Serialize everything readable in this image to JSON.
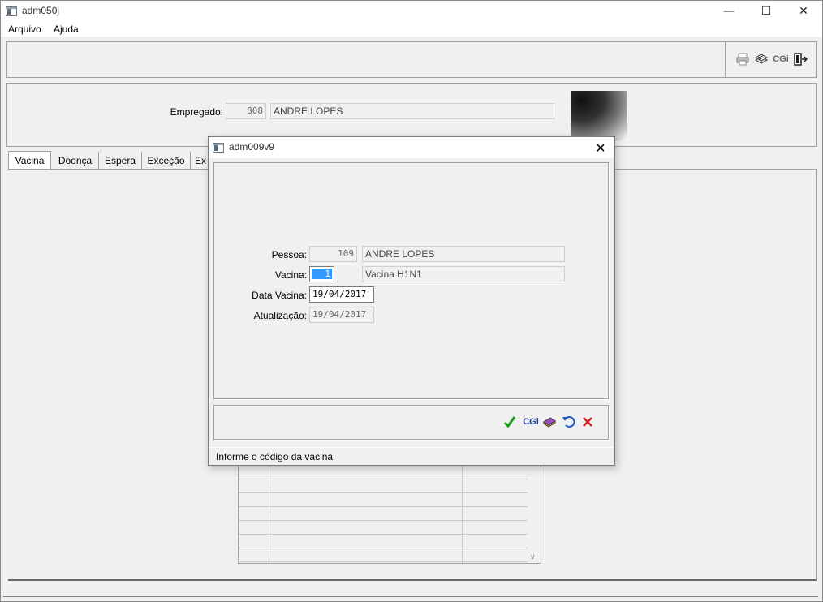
{
  "window": {
    "title": "adm050j",
    "minimize": "—",
    "maximize": "☐",
    "close": "✕"
  },
  "menu": {
    "items": [
      "Arquivo",
      "Ajuda"
    ]
  },
  "toolbar": {
    "cgi_label": "CGi",
    "icons": [
      "printer-icon",
      "print-preview-icon",
      "cgi-icon",
      "exit-door-icon"
    ]
  },
  "employee": {
    "label": "Empregado:",
    "code": "808",
    "name": "ANDRE LOPES"
  },
  "tabs": [
    {
      "label": "Vacina",
      "active": true
    },
    {
      "label": "Doença",
      "active": false
    },
    {
      "label": "Espera",
      "active": false
    },
    {
      "label": "Exceção",
      "active": false
    },
    {
      "label": "Ex",
      "active": false
    }
  ],
  "dialog": {
    "title": "adm009v9",
    "close": "✕",
    "fields": {
      "pessoa_label": "Pessoa:",
      "pessoa_code": "109",
      "pessoa_name": "ANDRE LOPES",
      "vacina_label": "Vacina:",
      "vacina_code": "1",
      "vacina_name": "Vacina H1N1",
      "data_label": "Data Vacina:",
      "data_value": "19/04/2017",
      "atualizacao_label": "Atualização:",
      "atualizacao_value": "19/04/2017"
    },
    "buttons": {
      "cgi_label": "CGi",
      "icons": [
        "confirm-check-icon",
        "cgi-icon",
        "book-icon",
        "undo-icon",
        "cancel-x-icon"
      ]
    },
    "status": "Informe o código da vacina"
  },
  "colors": {
    "window_bg": "#f0f0f0",
    "selection": "#3399ff",
    "confirm_green": "#1a9a1a",
    "cancel_red": "#d42020",
    "cgi_blue": "#1f3f9f"
  }
}
